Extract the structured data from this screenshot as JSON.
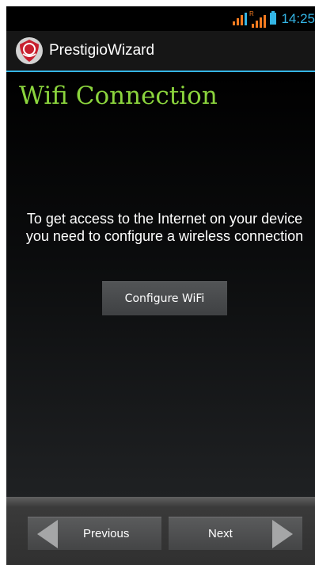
{
  "status_bar": {
    "time": "14:25",
    "roaming_indicator": "R"
  },
  "action_bar": {
    "app_title": "PrestigioWizard",
    "app_icon": "prestigio-logo-icon"
  },
  "main": {
    "title": "Wifi Connection",
    "message": "To get access to the Internet on your device you need to configure a wireless connection",
    "configure_button": "Configure WiFi"
  },
  "bottom_nav": {
    "previous_label": "Previous",
    "next_label": "Next"
  },
  "colors": {
    "accent": "#34b5e5",
    "title_green": "#8bd43d",
    "signal_orange": "#f47b20",
    "logo_red": "#c8202f"
  }
}
